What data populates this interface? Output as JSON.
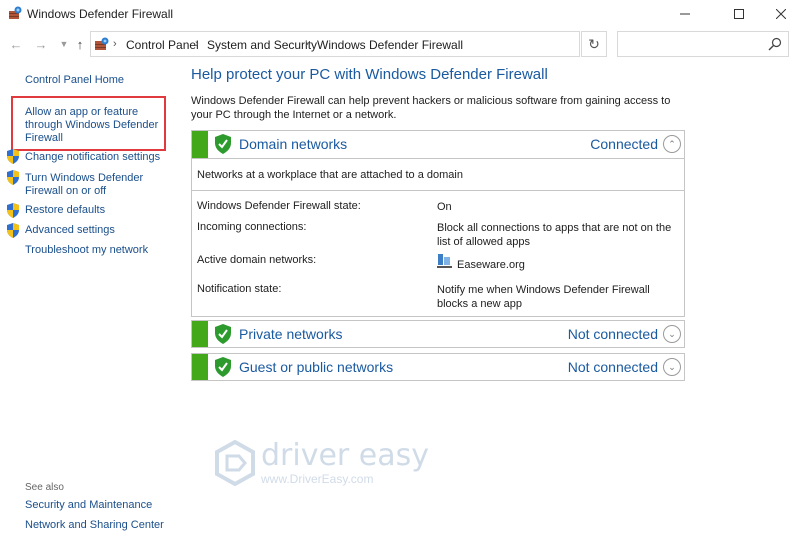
{
  "window": {
    "title": "Windows Defender Firewall"
  },
  "address": {
    "crumbs": [
      "Control Panel",
      "System and Security",
      "Windows Defender Firewall"
    ],
    "search_placeholder": ""
  },
  "sidebar": {
    "home": "Control Panel Home",
    "items": [
      {
        "label": "Allow an app or feature through Windows Defender Firewall",
        "lines": [
          "Allow an app or feature",
          "through Windows Defender",
          "Firewall"
        ],
        "shield": false
      },
      {
        "label": "Change notification settings",
        "shield": true
      },
      {
        "label": "Turn Windows Defender Firewall on or off",
        "lines": [
          "Turn Windows Defender",
          "Firewall on or off"
        ],
        "shield": true
      },
      {
        "label": "Restore defaults",
        "shield": true
      },
      {
        "label": "Advanced settings",
        "shield": true
      },
      {
        "label": "Troubleshoot my network",
        "shield": false
      }
    ],
    "see_also_label": "See also",
    "see_also": [
      "Security and Maintenance",
      "Network and Sharing Center"
    ]
  },
  "main": {
    "title": "Help protect your PC with Windows Defender Firewall",
    "intro": "Windows Defender Firewall can help prevent hackers or malicious software from gaining access to your PC through the Internet or a network.",
    "networks": [
      {
        "name": "Domain networks",
        "status": "Connected",
        "expanded": true,
        "description": "Networks at a workplace that are attached to a domain",
        "details": [
          {
            "label": "Windows Defender Firewall state:",
            "value": "On"
          },
          {
            "label": "Incoming connections:",
            "value": "Block all connections to apps that are not on the list of allowed apps"
          },
          {
            "label": "Active domain networks:",
            "value": "Easeware.org"
          },
          {
            "label": "Notification state:",
            "value": "Notify me when Windows Defender Firewall blocks a new app"
          }
        ]
      },
      {
        "name": "Private networks",
        "status": "Not connected",
        "expanded": false
      },
      {
        "name": "Guest or public networks",
        "status": "Not connected",
        "expanded": false
      }
    ]
  },
  "watermark": {
    "brand": "driver easy",
    "url": "www.DriverEasy.com"
  },
  "colors": {
    "accent": "#1a5aa0",
    "link": "#1a4f8b",
    "green": "#44a81b",
    "highlight": "#e03a3e"
  }
}
